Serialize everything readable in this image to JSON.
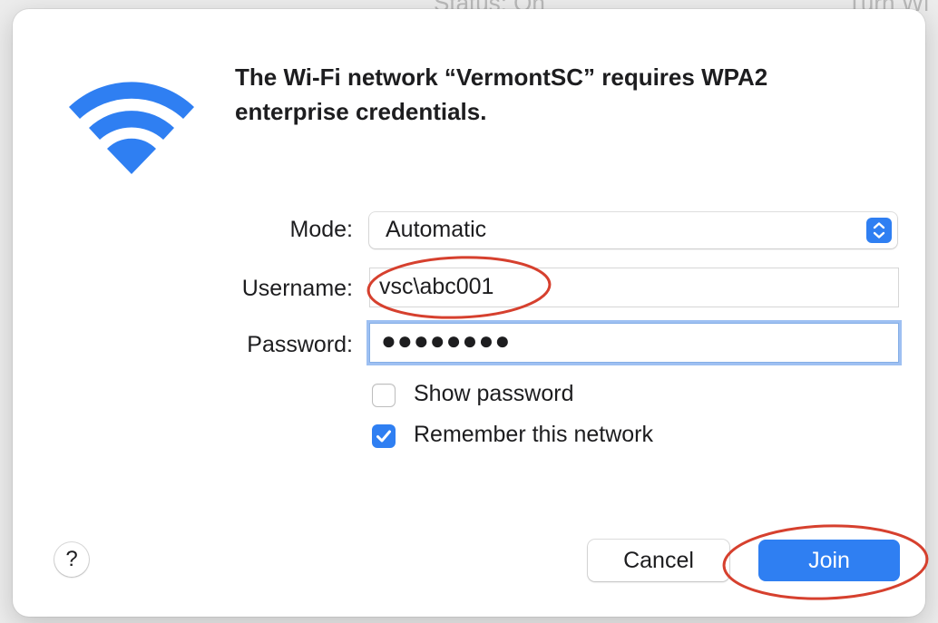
{
  "background": {
    "status_text": "Status: On",
    "turn_text": "Turn Wi"
  },
  "dialog": {
    "title": "The Wi-Fi network “VermontSC” requires WPA2 enterprise credentials.",
    "icon": "wifi-icon",
    "form": {
      "mode_label": "Mode:",
      "mode_value": "Automatic",
      "username_label": "Username:",
      "username_value": "vsc\\abc001",
      "password_label": "Password:",
      "password_masked": "●●●●●●●●"
    },
    "options": {
      "show_password": {
        "label": "Show password",
        "checked": false
      },
      "remember_network": {
        "label": "Remember this network",
        "checked": true
      }
    },
    "buttons": {
      "help": "?",
      "cancel": "Cancel",
      "join": "Join"
    }
  },
  "colors": {
    "accent": "#2f7ff2",
    "annotation": "#d6402e"
  }
}
